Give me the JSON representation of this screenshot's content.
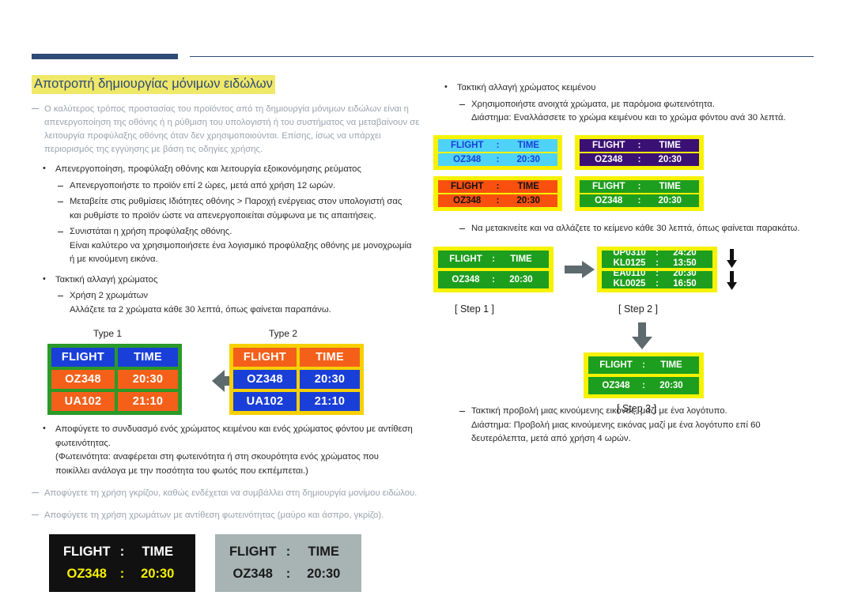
{
  "header": {
    "accent_color": "#2e4a77"
  },
  "left": {
    "title": "Αποτροπή δημιουργίας μόνιμων ειδώλων",
    "title_highlight": "#efe868",
    "note1": "Ο καλύτερος τρόπος προστασίας του προϊόντος από τη δημιουργία μόνιμων ειδώλων είναι η απενεργοποίηση της οθόνης ή η ρύθμιση του υπολογιστή ή του συστήματος να μεταβαίνουν σε λειτουργία προφύλαξης οθόνης όταν δεν χρησιμοποιούνται. Επίσης, ίσως να υπάρχει περιορισμός της εγγύησης με βάση τις οδηγίες χρήσης.",
    "bullet1": "Απενεργοποίηση, προφύλαξη οθόνης και λειτουργία εξοικονόμησης ρεύματος",
    "dash1": "Απενεργοποιήστε το προϊόν επί 2 ώρες, μετά από χρήση 12 ωρών.",
    "dash2": "Μεταβείτε στις ρυθμίσεις Ιδιότητες οθόνης > Παροχή ενέργειας στον υπολογιστή σας",
    "dash2b": "και ρυθμίστε το προϊόν ώστε να απενεργοποιείται σύμφωνα με τις απαιτήσεις.",
    "dash3": "Συνιστάται η χρήση προφύλαξης οθόνης.",
    "dash3b": "Είναι καλύτερο να χρησιμοποιήσετε ένα λογισμικό προφύλαξης οθόνης με μονοχρωμία",
    "dash3c": "ή με κινούμενη εικόνα.",
    "bullet2": "Τακτική αλλαγή χρώματος",
    "dash4": "Χρήση 2 χρωμάτων",
    "dash4b": "Αλλάζετε τα 2 χρώματα κάθε 30 λεπτά, όπως φαίνεται παραπάνω.",
    "type1_label": "Type 1",
    "type2_label": "Type 2",
    "bullet3": "Αποφύγετε το συνδυασμό ενός χρώματος κειμένου και ενός χρώματος φόντου με αντίθεση",
    "bullet3b": "φωτεινότητας.",
    "bullet3c": "(Φωτεινότητα: αναφέρεται στη φωτεινότητα ή στη σκουρότητα ενός χρώματος που",
    "bullet3d": "ποικίλλει ανάλογα με την ποσότητα του φωτός που εκπέμπεται.)",
    "note2": "Αποφύγετε τη χρήση γκρίζου, καθώς ενδέχεται να συμβάλλει στη δημιουργία μονίμου ειδώλου.",
    "note3": "Αποφύγετε τη χρήση χρωμάτων με αντίθεση φωτεινότητας (μαύρο και άσπρο, γκρίζο)."
  },
  "right": {
    "bullet1": "Τακτική αλλαγή χρώματος κειμένου",
    "dash1": "Χρησιμοποιήστε ανοιχτά χρώματα, με παρόμοια φωτεινότητα.",
    "dash1b": "Διάστημα: Εναλλάσσετε το χρώμα κειμένου και το χρώμα φόντου ανά 30 λεπτά.",
    "dash2": "Να μετακινείτε και να αλλάζετε το κείμενο κάθε 30 λεπτά, όπως φαίνεται παρακάτω.",
    "dash3": "Τακτική προβολή μιας κινούμενης εικόνας, μαζί με ένα λογότυπο.",
    "dash3b": "Διάστημα: Προβολή μιας κινούμενης εικόνας μαζί με ένα λογότυπο επί 60",
    "dash3c": "δευτερόλεπτα, μετά από χρήση 4 ωρών."
  },
  "labels": {
    "flight": "FLIGHT",
    "time": "TIME",
    "colon": ":",
    "flight_no": "OZ348",
    "flight_time": "20:30",
    "flight_no2": "UA102",
    "flight_time2": "21:10"
  },
  "type_tables": {
    "type1": {
      "frame_color": "#2a9a28",
      "header_bg": "#1a3fd8",
      "header_fg": "#ffffff",
      "body_bg": "#f4601a",
      "body_fg": "#ffffff",
      "rows": [
        [
          "FLIGHT",
          "TIME"
        ],
        [
          "OZ348",
          "20:30"
        ],
        [
          "UA102",
          "21:10"
        ]
      ]
    },
    "type2": {
      "frame_color": "#f7d000",
      "header_bg": "#f4601a",
      "header_fg": "#ffffff",
      "body_bg": "#1a3fd8",
      "body_fg": "#ffffff",
      "rows": [
        [
          "FLIGHT",
          "TIME"
        ],
        [
          "OZ348",
          "20:30"
        ],
        [
          "UA102",
          "21:10"
        ]
      ]
    }
  },
  "banners": [
    {
      "name": "black-banner",
      "bg": "#111111",
      "line1_fg": "#ffffff",
      "line2_fg": "#f5f000",
      "line1": [
        "FLIGHT",
        ":",
        "TIME"
      ],
      "line2": [
        "OZ348",
        ":",
        "20:30"
      ]
    },
    {
      "name": "gray-banner",
      "bg": "#a8b4b4",
      "line1_fg": "#1a1a1a",
      "line2_fg": "#1a1a1a",
      "line1": [
        "FLIGHT",
        ":",
        "TIME"
      ],
      "line2": [
        "OZ348",
        ":",
        "20:30"
      ]
    }
  ],
  "color_panels": [
    {
      "name": "cyan-panel",
      "frame": "#f7f200",
      "bg": "#4fd2f7",
      "fg": "#1a3fd8",
      "line1": [
        "FLIGHT",
        ":",
        "TIME"
      ],
      "line2": [
        "OZ348",
        ":",
        "20:30"
      ]
    },
    {
      "name": "purple-panel",
      "frame": "#f7f200",
      "bg": "#3b1075",
      "fg": "#ffffff",
      "line1": [
        "FLIGHT",
        ":",
        "TIME"
      ],
      "line2": [
        "OZ348",
        ":",
        "20:30"
      ]
    },
    {
      "name": "orange-panel",
      "frame": "#f7f200",
      "bg": "#f9500f",
      "fg": "#111111",
      "line1": [
        "FLIGHT",
        ":",
        "TIME"
      ],
      "line2": [
        "OZ348",
        ":",
        "20:30"
      ]
    },
    {
      "name": "green-panel",
      "frame": "#f7f200",
      "bg": "#1e9e1e",
      "fg": "#ffffff",
      "line1": [
        "FLIGHT",
        ":",
        "TIME"
      ],
      "line2": [
        "OZ348",
        ":",
        "20:30"
      ]
    }
  ],
  "steps": {
    "step1_caption": "[ Step 1 ]",
    "step2_caption": "[ Step 2 ]",
    "step3_caption": "[ Step 3 ]",
    "step1": {
      "line1": [
        "FLIGHT",
        ":",
        "TIME"
      ],
      "line2": [
        "OZ348",
        ":",
        "20:30"
      ]
    },
    "step2": {
      "row1_top": [
        "UP0310",
        ":",
        "24:20"
      ],
      "row1_bot": [
        "KL0125",
        ":",
        "13:50"
      ],
      "row2_top": [
        "EA0110",
        ":",
        "20:30"
      ],
      "row2_bot": [
        "KL0025",
        ":",
        "16:50"
      ]
    },
    "step3": {
      "line1": [
        "FLIGHT",
        ":",
        "TIME"
      ],
      "line2": [
        "OZ348",
        ":",
        "20:30"
      ]
    }
  }
}
